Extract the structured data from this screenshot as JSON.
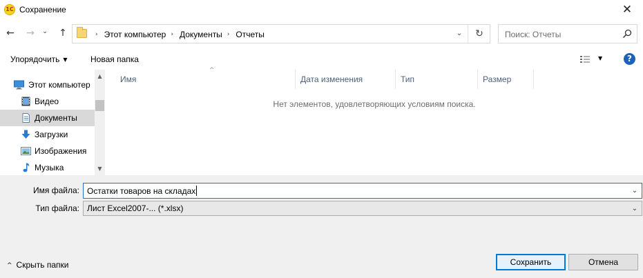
{
  "window": {
    "title": "Сохранение",
    "app_logo_text": "1С",
    "close_glyph": "✕"
  },
  "nav": {
    "back_glyph": "←",
    "forward_glyph": "→",
    "recent_glyph": "⌄",
    "up_glyph": "↑",
    "breadcrumb": [
      "Этот компьютер",
      "Документы",
      "Отчеты"
    ],
    "crumb_separator": "›",
    "dropdown_glyph": "⌄",
    "refresh_glyph": "↻"
  },
  "search": {
    "placeholder": "Поиск: Отчеты"
  },
  "toolbar": {
    "organize_label": "Упорядочить",
    "organize_arrow": "▼",
    "new_folder_label": "Новая папка",
    "view_arrow": "▼",
    "help_glyph": "?"
  },
  "sidebar": {
    "items": [
      {
        "label": "Этот компьютер",
        "icon": "computer-icon",
        "selected": false
      },
      {
        "label": "Видео",
        "icon": "video-icon",
        "selected": false
      },
      {
        "label": "Документы",
        "icon": "documents-icon",
        "selected": true
      },
      {
        "label": "Загрузки",
        "icon": "downloads-icon",
        "selected": false
      },
      {
        "label": "Изображения",
        "icon": "pictures-icon",
        "selected": false
      },
      {
        "label": "Музыка",
        "icon": "music-icon",
        "selected": false
      }
    ],
    "scroll_up_glyph": "▲",
    "scroll_down_glyph": "▼"
  },
  "filelist": {
    "columns": [
      "Имя",
      "Дата изменения",
      "Тип",
      "Размер"
    ],
    "sort_glyph": "^",
    "empty_message": "Нет элементов, удовлетворяющих условиям поиска."
  },
  "form": {
    "filename_label": "Имя файла:",
    "filename_value": "Остатки товаров на складах",
    "filetype_label": "Тип файла:",
    "filetype_value": "Лист Excel2007-... (*.xlsx)",
    "combo_glyph": "⌄"
  },
  "footer": {
    "hide_folders_glyph": "^",
    "hide_folders_label": "Скрыть папки",
    "save_label": "Сохранить",
    "cancel_label": "Отмена"
  },
  "colors": {
    "accent": "#0078d7",
    "help_blue": "#1c62b9",
    "selected_bg": "#d9d9d9",
    "bottom_bg": "#f0f0f0"
  }
}
